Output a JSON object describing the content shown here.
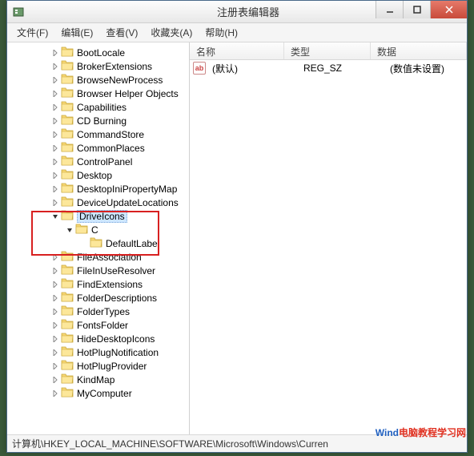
{
  "window": {
    "title": "注册表编辑器"
  },
  "menu": {
    "file": "文件(F)",
    "edit": "编辑(E)",
    "view": "查看(V)",
    "favorites": "收藏夹(A)",
    "help": "帮助(H)"
  },
  "tree": {
    "items": [
      {
        "indent": 3,
        "exp": "closed",
        "label": "BootLocale"
      },
      {
        "indent": 3,
        "exp": "closed",
        "label": "BrokerExtensions"
      },
      {
        "indent": 3,
        "exp": "closed",
        "label": "BrowseNewProcess"
      },
      {
        "indent": 3,
        "exp": "closed",
        "label": "Browser Helper Objects"
      },
      {
        "indent": 3,
        "exp": "closed",
        "label": "Capabilities"
      },
      {
        "indent": 3,
        "exp": "closed",
        "label": "CD Burning"
      },
      {
        "indent": 3,
        "exp": "closed",
        "label": "CommandStore"
      },
      {
        "indent": 3,
        "exp": "closed",
        "label": "CommonPlaces"
      },
      {
        "indent": 3,
        "exp": "closed",
        "label": "ControlPanel"
      },
      {
        "indent": 3,
        "exp": "closed",
        "label": "Desktop"
      },
      {
        "indent": 3,
        "exp": "closed",
        "label": "DesktopIniPropertyMap"
      },
      {
        "indent": 3,
        "exp": "closed",
        "label": "DeviceUpdateLocations"
      },
      {
        "indent": 3,
        "exp": "open",
        "label": "DriveIcons",
        "selected": true
      },
      {
        "indent": 4,
        "exp": "open",
        "label": "C"
      },
      {
        "indent": 5,
        "exp": "none",
        "label": "DefaultLabel"
      },
      {
        "indent": 3,
        "exp": "closed",
        "label": "FileAssociation"
      },
      {
        "indent": 3,
        "exp": "closed",
        "label": "FileInUseResolver"
      },
      {
        "indent": 3,
        "exp": "closed",
        "label": "FindExtensions"
      },
      {
        "indent": 3,
        "exp": "closed",
        "label": "FolderDescriptions"
      },
      {
        "indent": 3,
        "exp": "closed",
        "label": "FolderTypes"
      },
      {
        "indent": 3,
        "exp": "closed",
        "label": "FontsFolder"
      },
      {
        "indent": 3,
        "exp": "closed",
        "label": "HideDesktopIcons"
      },
      {
        "indent": 3,
        "exp": "closed",
        "label": "HotPlugNotification"
      },
      {
        "indent": 3,
        "exp": "closed",
        "label": "HotPlugProvider"
      },
      {
        "indent": 3,
        "exp": "closed",
        "label": "KindMap"
      },
      {
        "indent": 3,
        "exp": "closed",
        "label": "MyComputer"
      }
    ]
  },
  "list": {
    "headers": {
      "name": "名称",
      "type": "类型",
      "data": "数据"
    },
    "rows": [
      {
        "icon": "ab",
        "name": "(默认)",
        "type": "REG_SZ",
        "data": "(数值未设置)"
      }
    ]
  },
  "statusbar": {
    "path": "计算机\\HKEY_LOCAL_MACHINE\\SOFTWARE\\Microsoft\\Windows\\Curren"
  },
  "watermark": {
    "blue": "Wind",
    "red": "电脑教程学习网"
  }
}
